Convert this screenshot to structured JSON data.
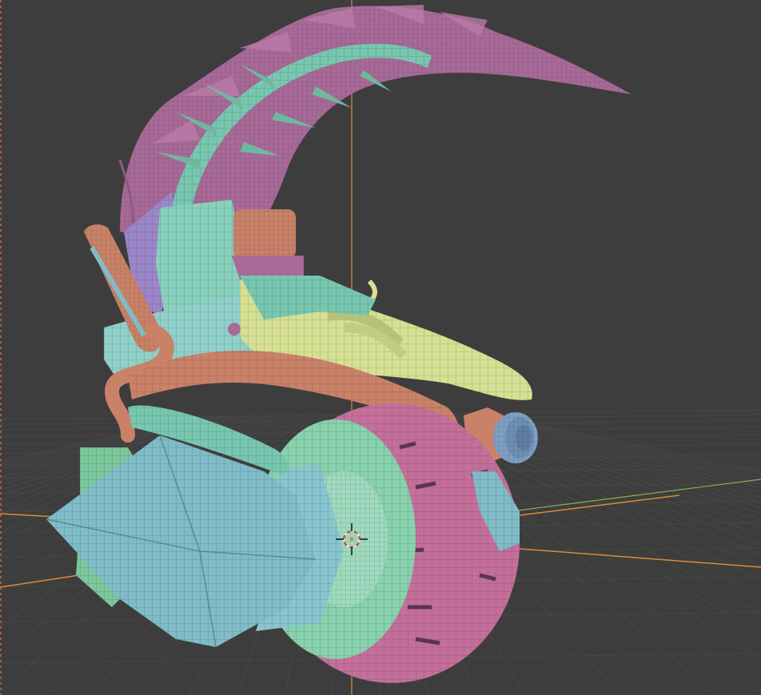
{
  "viewport": {
    "background_color": "#3d3d3d",
    "grid_color": "#474747",
    "x_axis_color": "#d98b3a",
    "y_axis_color": "#8fb04a",
    "z_axis_color": "#d98b3a"
  },
  "model": {
    "shading": "wireframe-on-solid",
    "part_colors": {
      "fins": "#a86a98",
      "frame": "#8fd0c8",
      "body": "#77c7b0",
      "strap": "#c98268",
      "cover": "#d6e092",
      "wheel_tire": "#c46f9a",
      "wheel_hub": "#88d1ad",
      "cone": "#7fbcc8",
      "lens": "#7f9fc4",
      "violet_panel": "#9b86c9"
    }
  },
  "gizmo": {
    "icon": "3d-cursor-icon"
  }
}
